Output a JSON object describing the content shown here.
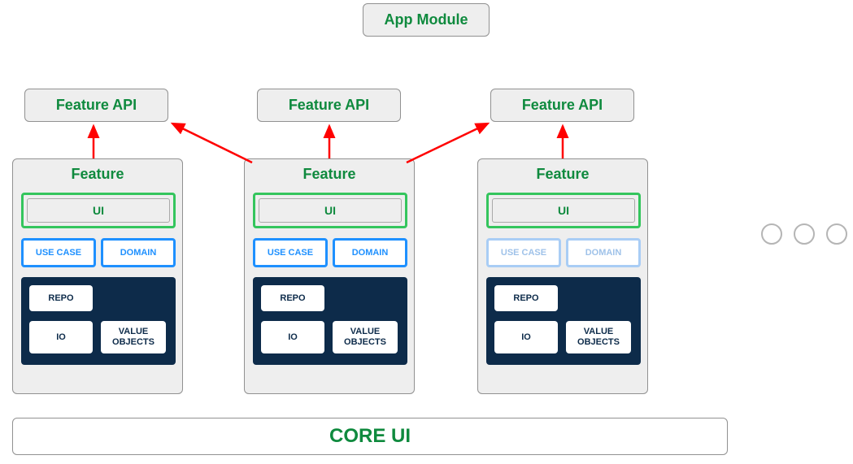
{
  "app_module": "App Module",
  "api": {
    "a": "Feature API",
    "b": "Feature API",
    "c": "Feature API"
  },
  "feature": {
    "title": "Feature",
    "ui": "UI",
    "use_case": "USE CASE",
    "domain": "DOMAIN",
    "repo": "REPO",
    "io": "IO",
    "value_objects": "VALUE\nOBJECTS"
  },
  "core_ui": "CORE UI",
  "colors": {
    "green": "#0f8a3e",
    "blue": "#1e90ff",
    "dark": "#0d2b4a",
    "arrow": "#ff0000"
  }
}
